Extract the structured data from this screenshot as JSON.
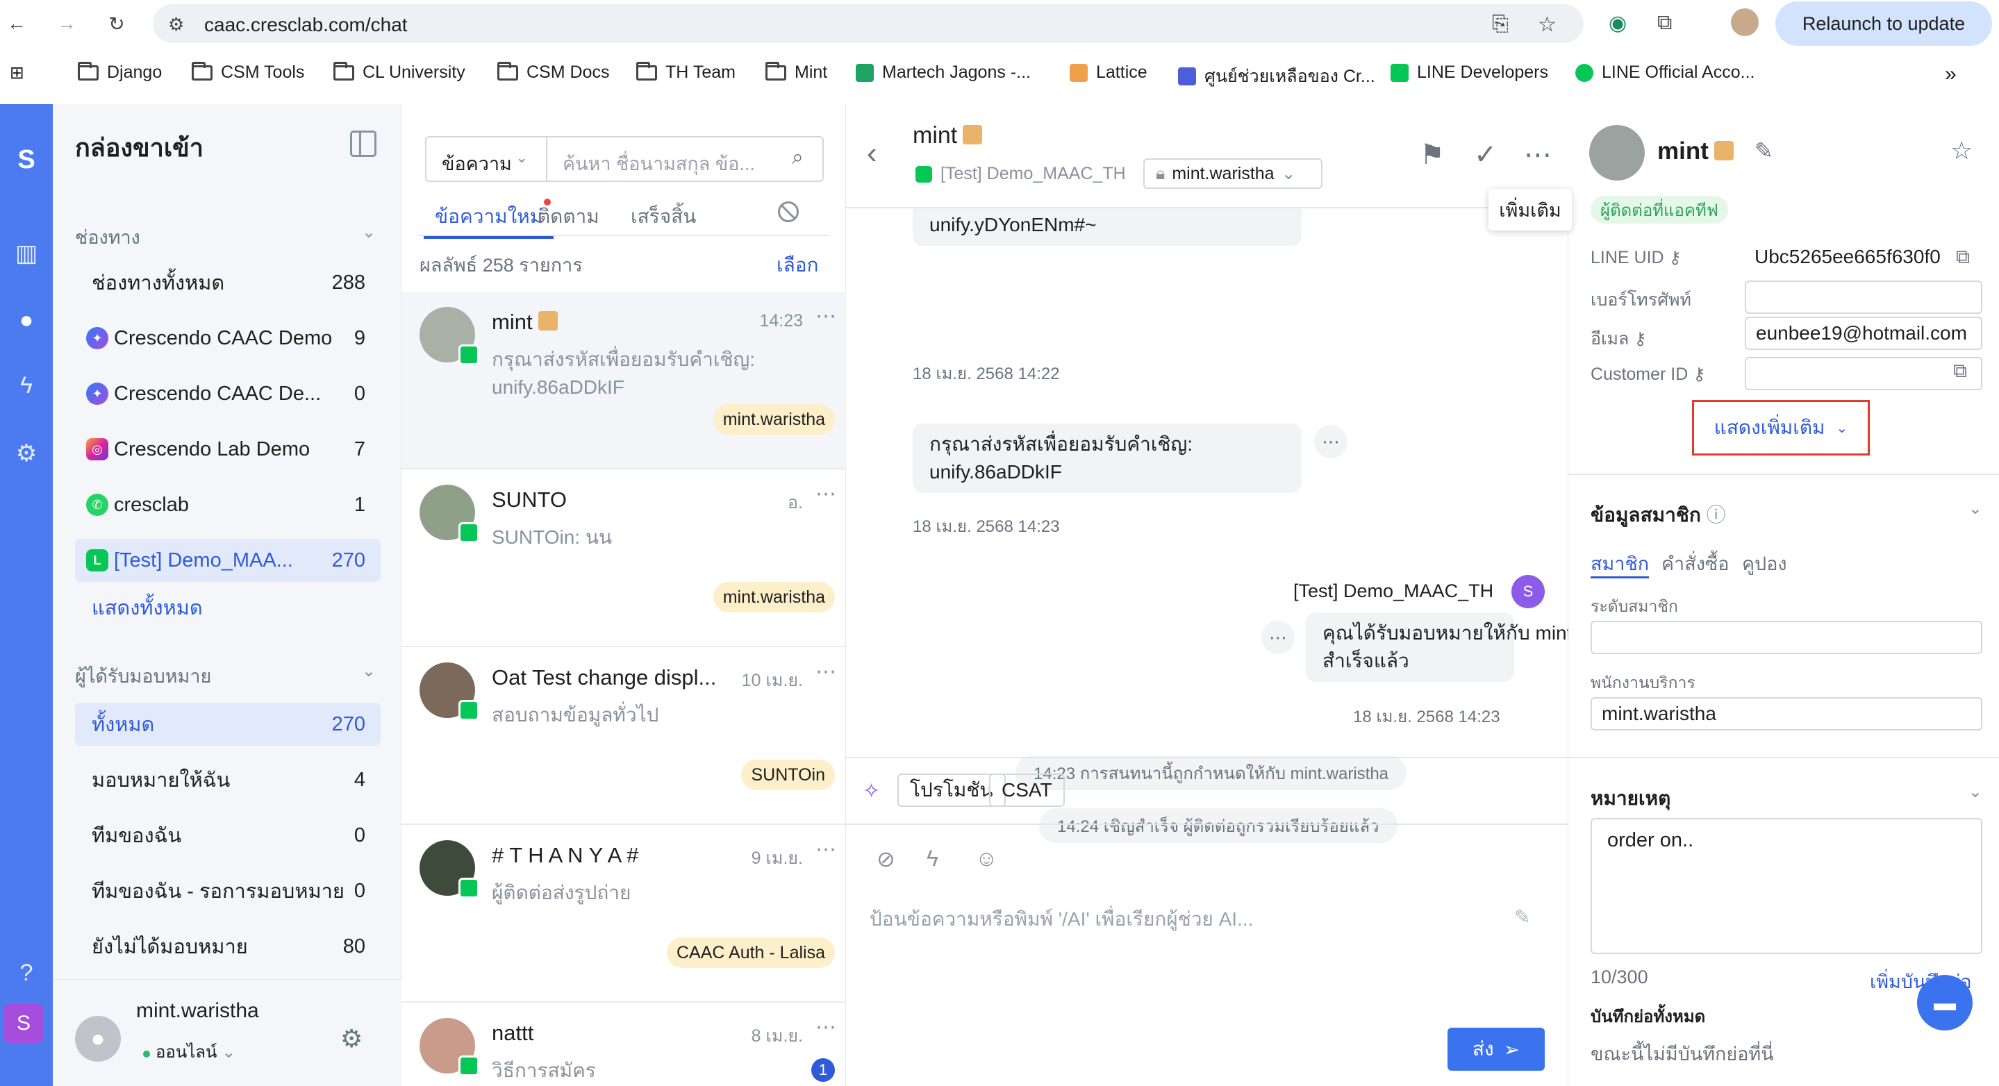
{
  "browser": {
    "url": "caac.cresclab.com/chat",
    "relaunch": "Relaunch to update",
    "bookmarks": [
      "Django",
      "CSM Tools",
      "CL University",
      "CSM Docs",
      "TH Team",
      "Mint",
      "Martech Jagons -...",
      "Lattice",
      "ศูนย์ช่วยเหลือของ Cr...",
      "LINE Developers",
      "LINE Official Acco..."
    ]
  },
  "sidebar": {
    "title": "กล่องขาเข้า",
    "channels_label": "ช่องทาง",
    "channels": [
      {
        "label": "ช่องทางทั้งหมด",
        "count": "288"
      },
      {
        "label": "Crescendo CAAC Demo",
        "count": "9"
      },
      {
        "label": "Crescendo CAAC De...",
        "count": "0"
      },
      {
        "label": "Crescendo Lab Demo",
        "count": "7"
      },
      {
        "label": "cresclab",
        "count": "1"
      },
      {
        "label": "[Test] Demo_MAA...",
        "count": "270"
      }
    ],
    "show_all": "แสดงทั้งหมด",
    "assignee_label": "ผู้ได้รับมอบหมาย",
    "assignees": [
      {
        "label": "ทั้งหมด",
        "count": "270"
      },
      {
        "label": "มอบหมายให้ฉัน",
        "count": "4"
      },
      {
        "label": "ทีมของฉัน",
        "count": "0"
      },
      {
        "label": "ทีมของฉัน - รอการมอบหมาย",
        "count": "0"
      },
      {
        "label": "ยังไม่ได้มอบหมาย",
        "count": "80"
      }
    ],
    "user": {
      "name": "mint.waristha",
      "status": "ออนไลน์"
    }
  },
  "list": {
    "filter": "ข้อความ",
    "search_placeholder": "ค้นหา ชื่อนามสกุล ข้อ...",
    "tabs": [
      "ข้อความใหม่",
      "ติดตาม",
      "เสร็จสิ้น"
    ],
    "results": "ผลลัพธ์ 258 รายการ",
    "select": "เลือก",
    "conversations": [
      {
        "name": "mint",
        "time": "14:23",
        "msg": "กรุณาส่งรหัสเพื่อยอมรับคำเชิญ: unify.86aDDkIF",
        "tag": "mint.waristha"
      },
      {
        "name": "SUNTO",
        "time": "อ.",
        "msg": "SUNTOin: นน",
        "tag": "mint.waristha"
      },
      {
        "name": "Oat Test change displ...",
        "time": "10 เม.ย.",
        "msg": "สอบถามข้อมูลทั่วไป",
        "tag": "SUNTOin"
      },
      {
        "name": "# T H A N Y A #",
        "time": "9 เม.ย.",
        "msg": "ผู้ติดต่อส่งรูปถ่าย",
        "tag": "CAAC Auth  -  Lalisa"
      },
      {
        "name": "nattt",
        "time": "8 เม.ย.",
        "msg": "วิธีการสมัคร",
        "unread": "1"
      }
    ]
  },
  "chat": {
    "name": "mint",
    "channel": "[Test] Demo_MAAC_TH",
    "assignee": "mint.waristha",
    "tooltip": "เพิ่มเติม",
    "messages": {
      "m1_text": "unify.yDYonENm#~",
      "m1_time": "18 เม.ย. 2568 14:22",
      "m2_line1": "กรุณาส่งรหัสเพื่อยอมรับคำเชิญ:",
      "m2_line2": "unify.86aDDkIF",
      "m2_time": "18 เม.ย. 2568 14:23",
      "sender": "[Test] Demo_MAAC_TH",
      "m3_line1": "คุณได้รับมอบหมายให้กับ mint.waristha",
      "m3_line2": "สำเร็จแล้ว",
      "m3_time": "18 เม.ย. 2568 14:23",
      "sys1": "14:23 การสนทนานี้ถูกกำหนดให้กับ  mint.waristha",
      "sys2": "14:24 เชิญสำเร็จ ผู้ติดต่อถูกรวมเรียบร้อยแล้ว"
    },
    "quick": [
      "โปรโมชัน",
      "CSAT"
    ],
    "composer_placeholder": "ป้อนข้อความหรือพิมพ์ '/AI' เพื่อเรียกผู้ช่วย AI...",
    "send": "ส่ง"
  },
  "profile": {
    "name": "mint",
    "tag": "ผู้ติดต่อที่แอคทีฟ",
    "fields": {
      "line_uid_label": "LINE UID",
      "line_uid": "Ubc5265ee665f630f0",
      "phone_label": "เบอร์โทรศัพท์",
      "email_label": "อีเมล",
      "email": "eunbee19@hotmail.com",
      "customer_id_label": "Customer ID"
    },
    "show_more": "แสดงเพิ่มเติม",
    "member_title": "ข้อมูลสมาชิก",
    "member_tabs": [
      "สมาชิก",
      "คำสั่งซื้อ",
      "คูปอง"
    ],
    "member_level_label": "ระดับสมาชิก",
    "staff_label": "พนักงานบริการ",
    "staff": "mint.waristha",
    "note_title": "หมายเหตุ",
    "note": "order on..",
    "note_count": "10/300",
    "add_memo": "เพิ่มบันทึกย่อ",
    "all_memos": "บันทึกย่อทั้งหมด",
    "no_memos": "ขณะนี้ไม่มีบันทึกย่อที่นี่"
  }
}
